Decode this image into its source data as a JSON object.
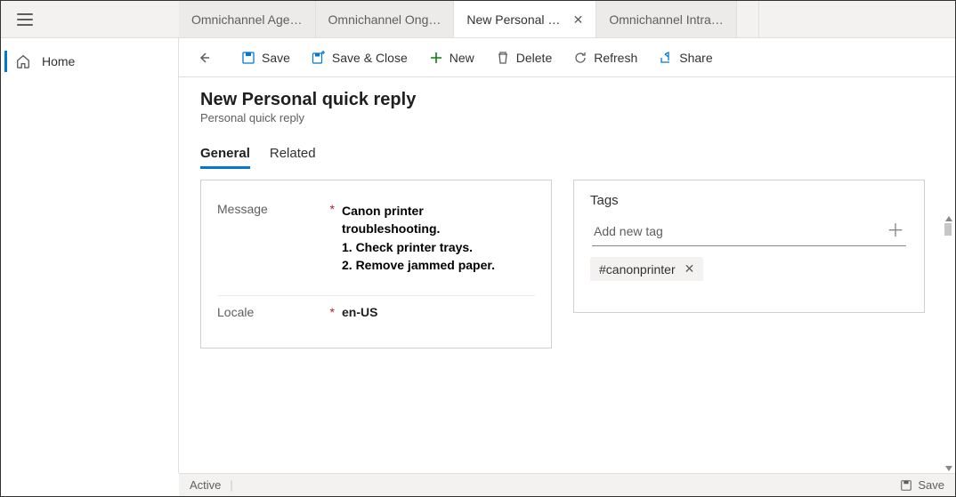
{
  "sidebar": {
    "items": [
      {
        "label": "Home"
      }
    ]
  },
  "tabs": [
    {
      "label": "Omnichannel Age…",
      "active": false,
      "closable": false
    },
    {
      "label": "Omnichannel Ong…",
      "active": false,
      "closable": false
    },
    {
      "label": "New Personal quick reply",
      "active": true,
      "closable": true
    },
    {
      "label": "Omnichannel Intra…",
      "active": false,
      "closable": false
    }
  ],
  "commands": {
    "save": "Save",
    "save_close": "Save & Close",
    "new": "New",
    "delete": "Delete",
    "refresh": "Refresh",
    "share": "Share"
  },
  "page": {
    "title": "New Personal quick reply",
    "subtitle": "Personal quick reply"
  },
  "formTabs": {
    "general": "General",
    "related": "Related"
  },
  "fields": {
    "message_label": "Message",
    "message_value": "Canon printer troubleshooting.\n1. Check printer trays.\n2. Remove jammed paper.",
    "locale_label": "Locale",
    "locale_value": "en-US"
  },
  "tagsPanel": {
    "title": "Tags",
    "placeholder": "Add new tag",
    "tags": [
      {
        "text": "#canonprinter"
      }
    ]
  },
  "footer": {
    "status": "Active",
    "save": "Save"
  }
}
